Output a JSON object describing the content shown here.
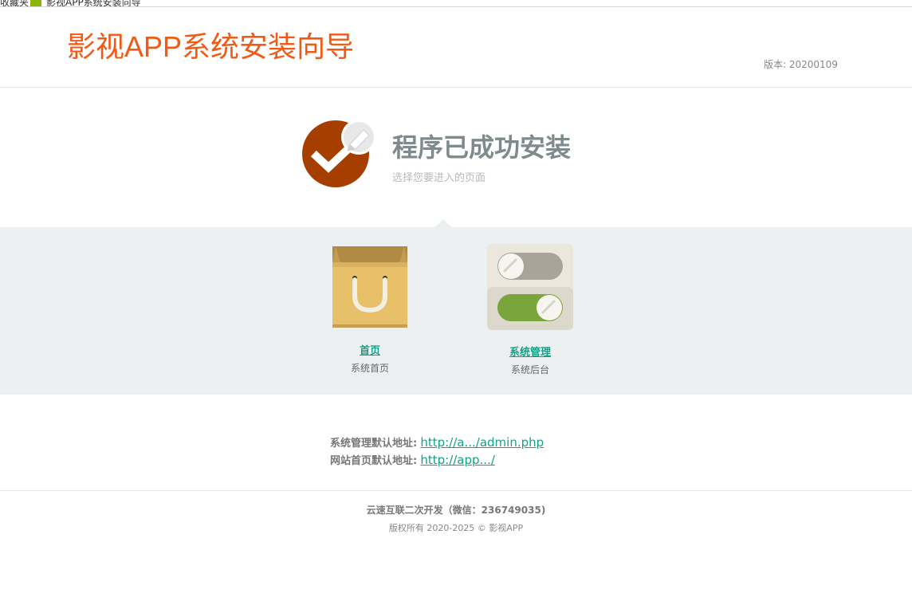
{
  "browser": {
    "favorites_label": "收藏夹",
    "tab_label": "影视APP系统安装向导"
  },
  "header": {
    "title": "影视APP系统安装向导",
    "version": "版本: 20200109"
  },
  "success": {
    "title": "程序已成功安装",
    "subtitle": "选择您要进入的页面"
  },
  "choices": [
    {
      "label": "首页",
      "desc": "系统首页",
      "icon": "shopping-bag-icon"
    },
    {
      "label": "系统管理",
      "desc": "系统后台",
      "icon": "toggle-switches-icon"
    }
  ],
  "links": {
    "admin_label": "系统管理默认地址:",
    "admin_url": "http://a.../admin.php",
    "home_label": "网站首页默认地址:",
    "home_url": "http://app.../"
  },
  "footer": {
    "developer": "云速互联二次开发（微信：236749035)",
    "copyright": "版权所有 2020-2025 © 影视APP"
  },
  "colors": {
    "title_orange": "#f05a14",
    "check_brown": "#a63e00",
    "link_green": "#16a085",
    "band_gray": "#ecf0f1"
  }
}
